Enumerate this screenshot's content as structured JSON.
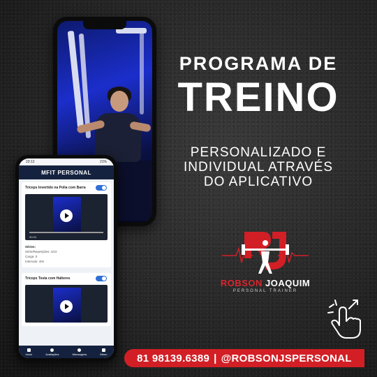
{
  "headline": {
    "line1": "PROGRAMA DE",
    "line2": "TREINO"
  },
  "subtitle": {
    "lines": [
      "PERSONALIZADO E",
      "INDIVIDUAL ATRAVÉS",
      "DO APLICATIVO"
    ]
  },
  "app": {
    "status_time": "23:12",
    "status_right": "21%",
    "header_title": "MFIT PERSONAL",
    "exercises": [
      {
        "name": "Tríceps Invertido na Polia com Barra",
        "video_time": "00:00",
        "series_label": "Séries:",
        "reps_line": "Série/Repetições: 4/10",
        "load_line": "Carga: 0",
        "interval_line": "Intervalo: 40s"
      },
      {
        "name": "Tríceps Testa com Halteres"
      }
    ],
    "nav": [
      "Início",
      "Avaliações",
      "Mensagens",
      "Menu"
    ]
  },
  "brand": {
    "first": "ROBSON",
    "last": "JOAQUIM",
    "role": "PERSONAL TRAINER"
  },
  "contact": {
    "phone": "81 98139.6389",
    "separator": "|",
    "handle": "@ROBSONJSPERSONAL"
  },
  "colors": {
    "accent": "#d21f26",
    "app_header": "#15223f",
    "toggle": "#2f6fd6"
  },
  "icons": [
    "play-icon",
    "tap-hand-icon",
    "home-icon",
    "chat-icon",
    "menu-icon"
  ]
}
